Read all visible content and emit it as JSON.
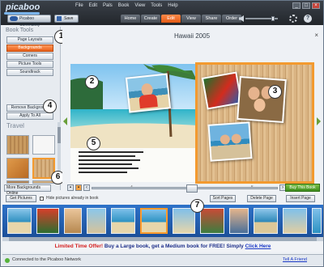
{
  "app": {
    "logo": "picaboo",
    "menu": [
      "File",
      "Edit",
      "Pals",
      "Book",
      "View",
      "Tools",
      "Help"
    ],
    "community_button": "Picaboo Community",
    "save_button": "Save",
    "tabs": [
      {
        "label": "Home",
        "active": false
      },
      {
        "label": "Create",
        "active": false
      },
      {
        "label": "Edit",
        "active": true
      },
      {
        "label": "View",
        "active": false
      },
      {
        "label": "Share",
        "active": false
      },
      {
        "label": "Order",
        "active": false
      }
    ],
    "volume_level": 0.9,
    "accent_color": "#e85f17"
  },
  "left_panel": {
    "title": "Book Tools",
    "tools": [
      {
        "label": "Page Layouts",
        "active": false
      },
      {
        "label": "Backgrounds",
        "active": true
      },
      {
        "label": "Corners",
        "active": false
      },
      {
        "label": "Picture Tools",
        "active": false
      },
      {
        "label": "Soundtrack",
        "active": false
      }
    ],
    "remove_background": "Remove Background",
    "apply_to_all": "Apply To All",
    "category": "Travel",
    "more_backgrounds": "More Backgrounds Online"
  },
  "book": {
    "title": "Hawaii 2005",
    "left_page_number": "4",
    "right_page_number": "5",
    "buy_button": "Buy This Book"
  },
  "strip_bar": {
    "get_pictures": "Get Pictures",
    "hide_label": "Hide pictures already in book",
    "sort_pages": "Sort Pages",
    "delete_page": "Delete Page",
    "insert_page": "Insert Page"
  },
  "callouts": [
    "1",
    "2",
    "3",
    "4",
    "5",
    "6",
    "7"
  ],
  "promo": {
    "offer": "Limited Time Offer!",
    "text": "Buy a Large book, get a Medium book for FREE! Simply",
    "link": "Click Here"
  },
  "status": {
    "connection": "Connected to the Picaboo Network",
    "tell_friend": "Tell A Friend"
  }
}
